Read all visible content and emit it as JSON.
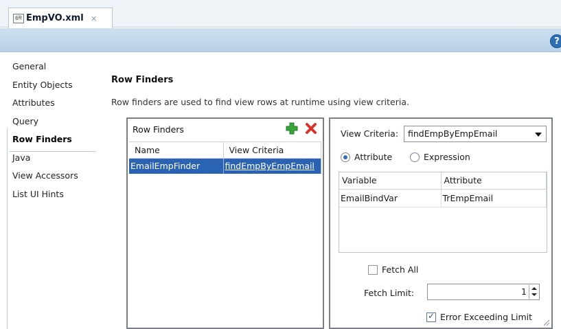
{
  "tab": {
    "title": "EmpVO.xml",
    "close": "×",
    "icon_text": "6ঈ"
  },
  "toolbar": {
    "help": "?"
  },
  "nav": {
    "items": [
      {
        "label": "General",
        "selected": false
      },
      {
        "label": "Entity Objects",
        "selected": false
      },
      {
        "label": "Attributes",
        "selected": false
      },
      {
        "label": "Query",
        "selected": false
      },
      {
        "label": "Row Finders",
        "selected": true
      },
      {
        "label": "Java",
        "selected": false
      },
      {
        "label": "View Accessors",
        "selected": false
      },
      {
        "label": "List UI Hints",
        "selected": false
      }
    ]
  },
  "content": {
    "title": "Row Finders",
    "description": "Row finders are used to find view rows at runtime using view criteria."
  },
  "row_finders": {
    "header": "Row Finders",
    "add_icon": "add-icon",
    "remove_icon": "remove-icon",
    "columns": [
      "Name",
      "View Criteria"
    ],
    "rows": [
      {
        "name": "EmailEmpFinder",
        "view_criteria": "findEmpByEmpEmail"
      }
    ]
  },
  "view_criteria": {
    "label": "View Criteria:",
    "selected": "findEmpByEmpEmail",
    "radio_attribute": "Attribute",
    "radio_expression": "Expression",
    "radio_selected": "Attribute",
    "var_columns": [
      "Variable",
      "Attribute"
    ],
    "var_rows": [
      {
        "variable": "EmailBindVar",
        "attribute": "TrEmpEmail"
      }
    ],
    "fetch_all_label": "Fetch All",
    "fetch_all_checked": false,
    "fetch_limit_label": "Fetch Limit:",
    "fetch_limit_value": "1",
    "error_exceeding_label": "Error Exceeding Limit",
    "error_exceeding_checked": true
  },
  "colors": {
    "selection": "#2b63b3",
    "toolbar": "#c4d9ee",
    "add_green": "#3aa43a",
    "remove_red": "#d9302a",
    "help_blue": "#2d6fb4"
  }
}
